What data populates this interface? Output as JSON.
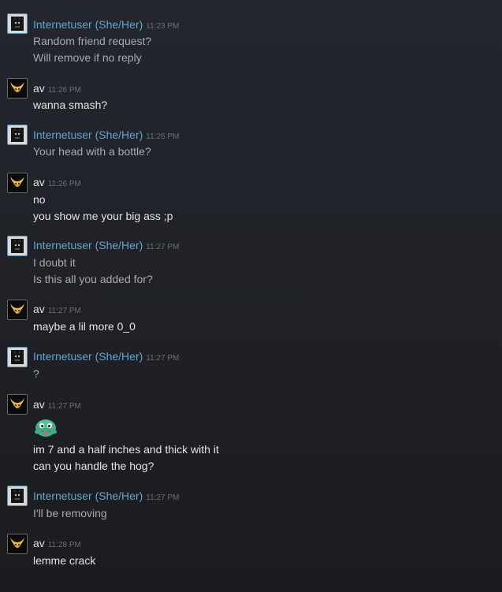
{
  "users": {
    "internetuser": {
      "name": "Internetuser (She/Her)",
      "color": "#62a6d0",
      "avatar_icon": "wolf-avatar-icon"
    },
    "av": {
      "name": "av",
      "color": "#e0e0e0",
      "avatar_icon": "horned-mask-avatar-icon"
    }
  },
  "messages": [
    {
      "author": "Internetuser (She/Her)",
      "time": "11:23 PM",
      "lines": [
        "Random friend request?",
        "Will remove if no reply"
      ]
    },
    {
      "author": "av",
      "time": "11:26 PM",
      "lines": [
        "wanna smash?"
      ]
    },
    {
      "author": "Internetuser (She/Her)",
      "time": "11:26 PM",
      "lines": [
        "Your head with a bottle?"
      ]
    },
    {
      "author": "av",
      "time": "11:26 PM",
      "lines": [
        "no",
        "you show me your big ass ;p"
      ]
    },
    {
      "author": "Internetuser (She/Her)",
      "time": "11:27 PM",
      "lines": [
        "I doubt it",
        "Is this all you added for?"
      ]
    },
    {
      "author": "av",
      "time": "11:27 PM",
      "lines": [
        "maybe a lil more 0_0"
      ]
    },
    {
      "author": "Internetuser (She/Her)",
      "time": "11:27 PM",
      "lines": [
        "?"
      ]
    },
    {
      "author": "av",
      "time": "11:27 PM",
      "emote": "green-tongue-emote-icon",
      "lines": [
        "im 7 and a half inches and thick with it",
        "can you handle the hog?"
      ]
    },
    {
      "author": "Internetuser (She/Her)",
      "time": "11:27 PM",
      "lines": [
        "I'll be removing"
      ]
    },
    {
      "author": "av",
      "time": "11:28 PM",
      "lines": [
        "lemme crack"
      ]
    }
  ]
}
